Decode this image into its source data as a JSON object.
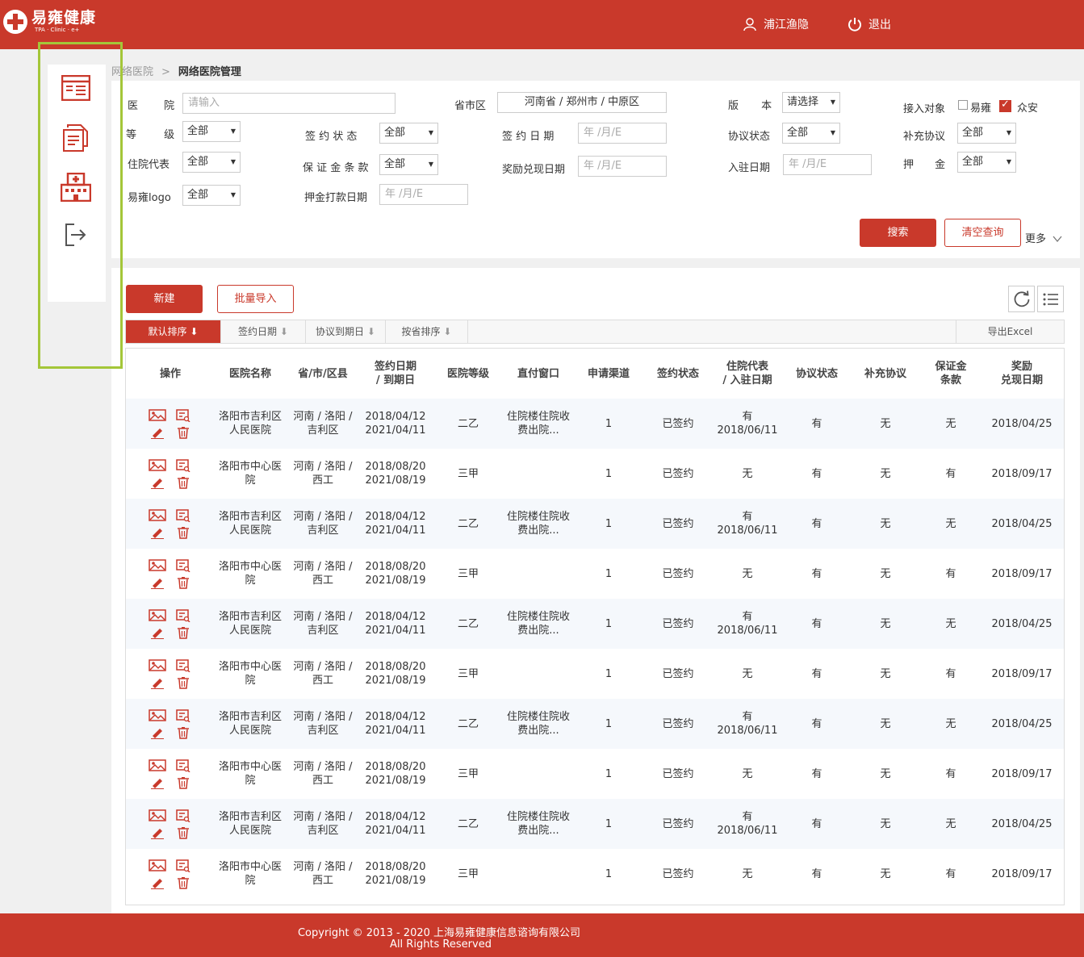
{
  "header": {
    "logo_title": "易雍健康",
    "logo_sub": "TPA · Clinic · e+",
    "user_name": "浦江渔隐",
    "logout_label": "退出"
  },
  "sidebar": {
    "items": [
      "form-list-icon",
      "documents-icon",
      "hospital-icon",
      "exit-icon"
    ]
  },
  "breadcrumb": {
    "parent": "网络医院",
    "separator": ">",
    "current": "网络医院管理"
  },
  "filters": {
    "hospital_label": "医 院",
    "hospital_placeholder": "请输入",
    "region_label": "省市区",
    "region_value": "河南省 / 郑州市 / 中原区",
    "version_label": "版 本",
    "version_value": "请选择",
    "access_label": "接入对象",
    "access_opt1": "易雍",
    "access_opt2": "众安",
    "grade_label": "等 级",
    "grade_value": "全部",
    "sign_status_label": "签 约 状 态",
    "sign_status_value": "全部",
    "sign_date_label": "签 约 日 期",
    "sign_date_placeholder": "年 /月/E",
    "agreement_status_label": "协议状态",
    "agreement_status_value": "全部",
    "supplement_label": "补充协议",
    "supplement_value": "全部",
    "rep_label": "住院代表",
    "rep_value": "全部",
    "deposit_terms_label": "保 证 金 条 款",
    "deposit_terms_value": "全部",
    "reward_date_label": "奖励兑现日期",
    "reward_date_placeholder": "年 /月/E",
    "entry_date_label": "入驻日期",
    "entry_date_placeholder": "年 /月/E",
    "deposit_label": "押 金",
    "deposit_value": "全部",
    "logo_label": "易雍logo",
    "logo_value": "全部",
    "deposit_pay_label": "押金打款日期",
    "deposit_pay_placeholder": "年 /月/E",
    "search_button": "搜索",
    "clear_button": "清空查询",
    "more_label": "更多"
  },
  "toolbar": {
    "new_button": "新建",
    "import_button": "批量导入",
    "refresh_icon": "refresh-icon",
    "columns_icon": "list-icon"
  },
  "sortbar": {
    "tabs": [
      "默认排序",
      "签约日期",
      "协议到期日",
      "按省排序"
    ],
    "export_label": "导出Excel"
  },
  "table": {
    "headers": [
      "操作",
      "医院名称",
      "省/市/区县",
      "签约日期\n/ 到期日",
      "医院等级",
      "直付窗口",
      "申请渠道",
      "签约状态",
      "住院代表\n/ 入驻日期",
      "协议状态",
      "补充协议",
      "保证金\n条款",
      "奖励\n兑现日期"
    ],
    "rows": [
      {
        "name": "洛阳市吉利区人民医院",
        "region": "河南 / 洛阳 / 吉利区",
        "dates": "2018/04/12 2021/04/11",
        "grade": "二乙",
        "window": "住院楼住院收费出院...",
        "channel": "1",
        "sign": "已签约",
        "rep": "有 2018/06/11",
        "agree": "有",
        "supp": "无",
        "deposit": "无",
        "reward": "2018/04/25"
      },
      {
        "name": "洛阳市中心医院",
        "region": "河南 / 洛阳 / 西工",
        "dates": "2018/08/20 2021/08/19",
        "grade": "三甲",
        "window": "",
        "channel": "1",
        "sign": "已签约",
        "rep": "无",
        "agree": "有",
        "supp": "无",
        "deposit": "有",
        "reward": "2018/09/17"
      },
      {
        "name": "洛阳市吉利区人民医院",
        "region": "河南 / 洛阳 / 吉利区",
        "dates": "2018/04/12 2021/04/11",
        "grade": "二乙",
        "window": "住院楼住院收费出院...",
        "channel": "1",
        "sign": "已签约",
        "rep": "有 2018/06/11",
        "agree": "有",
        "supp": "无",
        "deposit": "无",
        "reward": "2018/04/25"
      },
      {
        "name": "洛阳市中心医院",
        "region": "河南 / 洛阳 / 西工",
        "dates": "2018/08/20 2021/08/19",
        "grade": "三甲",
        "window": "",
        "channel": "1",
        "sign": "已签约",
        "rep": "无",
        "agree": "有",
        "supp": "无",
        "deposit": "有",
        "reward": "2018/09/17"
      },
      {
        "name": "洛阳市吉利区人民医院",
        "region": "河南 / 洛阳 / 吉利区",
        "dates": "2018/04/12 2021/04/11",
        "grade": "二乙",
        "window": "住院楼住院收费出院...",
        "channel": "1",
        "sign": "已签约",
        "rep": "有 2018/06/11",
        "agree": "有",
        "supp": "无",
        "deposit": "无",
        "reward": "2018/04/25"
      },
      {
        "name": "洛阳市中心医院",
        "region": "河南 / 洛阳 / 西工",
        "dates": "2018/08/20 2021/08/19",
        "grade": "三甲",
        "window": "",
        "channel": "1",
        "sign": "已签约",
        "rep": "无",
        "agree": "有",
        "supp": "无",
        "deposit": "有",
        "reward": "2018/09/17"
      },
      {
        "name": "洛阳市吉利区人民医院",
        "region": "河南 / 洛阳 / 吉利区",
        "dates": "2018/04/12 2021/04/11",
        "grade": "二乙",
        "window": "住院楼住院收费出院...",
        "channel": "1",
        "sign": "已签约",
        "rep": "有 2018/06/11",
        "agree": "有",
        "supp": "无",
        "deposit": "无",
        "reward": "2018/04/25"
      },
      {
        "name": "洛阳市中心医院",
        "region": "河南 / 洛阳 / 西工",
        "dates": "2018/08/20 2021/08/19",
        "grade": "三甲",
        "window": "",
        "channel": "1",
        "sign": "已签约",
        "rep": "无",
        "agree": "有",
        "supp": "无",
        "deposit": "有",
        "reward": "2018/09/17"
      },
      {
        "name": "洛阳市吉利区人民医院",
        "region": "河南 / 洛阳 / 吉利区",
        "dates": "2018/04/12 2021/04/11",
        "grade": "二乙",
        "window": "住院楼住院收费出院...",
        "channel": "1",
        "sign": "已签约",
        "rep": "有 2018/06/11",
        "agree": "有",
        "supp": "无",
        "deposit": "无",
        "reward": "2018/04/25"
      },
      {
        "name": "洛阳市中心医院",
        "region": "河南 / 洛阳 / 西工",
        "dates": "2018/08/20 2021/08/19",
        "grade": "三甲",
        "window": "",
        "channel": "1",
        "sign": "已签约",
        "rep": "无",
        "agree": "有",
        "supp": "无",
        "deposit": "有",
        "reward": "2018/09/17"
      }
    ],
    "row_ops": [
      "image-icon",
      "view-icon",
      "edit-icon",
      "delete-icon"
    ]
  },
  "footer": {
    "copyright": "Copyright © 2013 - 2020 上海易雍健康信息谘询有限公司",
    "rights": "All Rights Reserved"
  },
  "colors": {
    "brand": "#c9392b",
    "highlight": "#a4c639",
    "row_alt": "#f5f8fc"
  }
}
